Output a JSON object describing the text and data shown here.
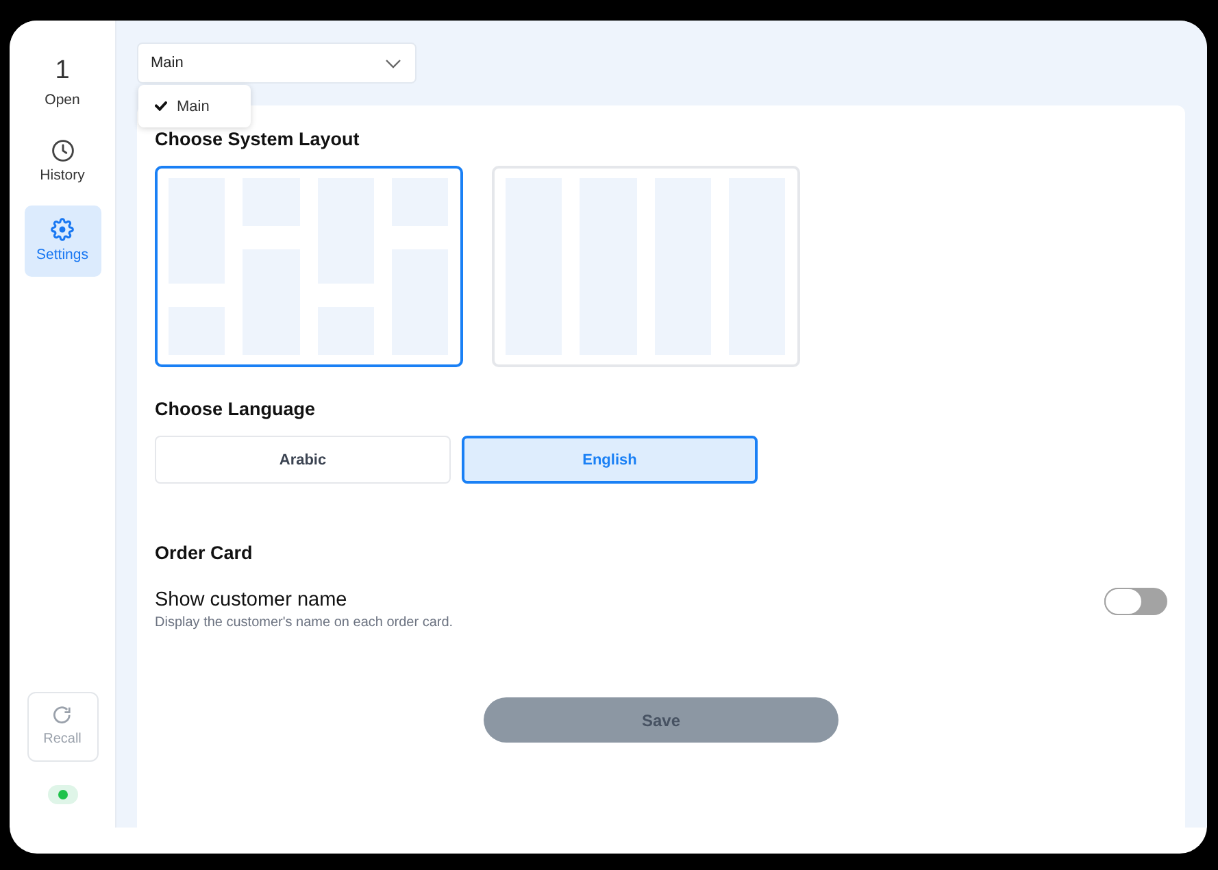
{
  "sidebar": {
    "items": [
      {
        "count": "1",
        "label": "Open",
        "selected": false
      },
      {
        "label": "History",
        "selected": false
      },
      {
        "label": "Settings",
        "selected": true
      }
    ],
    "recall_button": {
      "label": "Recall",
      "disabled": true
    },
    "connection": {
      "connected": true
    }
  },
  "branch_select": {
    "value": "Main",
    "expanded": true,
    "options": [
      {
        "label": "Main",
        "selected": true
      }
    ]
  },
  "system_layout": {
    "heading": "Choose System Layout",
    "options": [
      {
        "kind": "mixed",
        "selected": true
      },
      {
        "kind": "columns",
        "selected": false
      }
    ]
  },
  "language": {
    "heading": "Choose Language",
    "options": [
      {
        "label": "Arabic",
        "selected": false
      },
      {
        "label": "English",
        "selected": true
      }
    ]
  },
  "order_card": {
    "heading": "Order Card",
    "settings": [
      {
        "title": "Show customer name",
        "description": "Display the customer's name on each order card.",
        "on": false
      }
    ]
  },
  "save_button": {
    "label": "Save",
    "disabled": true
  }
}
